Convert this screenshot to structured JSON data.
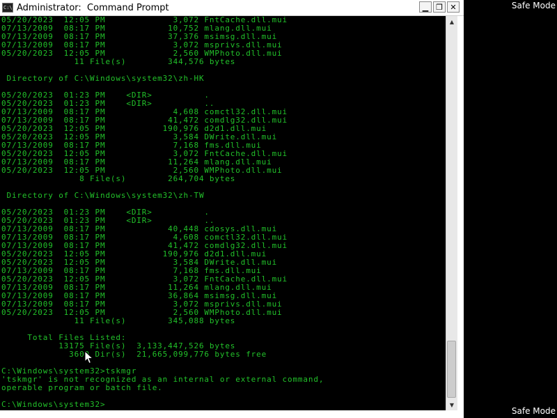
{
  "desktop": {
    "mode_label_top": "Safe Mode",
    "mode_label_bottom": "Safe Mode"
  },
  "window": {
    "title": "Administrator:  Command Prompt",
    "icon": "cmd-icon",
    "buttons": {
      "minimize_glyph": "▁",
      "maximize_glyph": "❐",
      "close_glyph": "✕"
    }
  },
  "console": {
    "text_color": "#22c22a",
    "background": "#000000",
    "lines": [
      "05/20/2023  12:05 PM             3,072 FntCache.dll.mui",
      "07/13/2009  08:17 PM            10,752 mlang.dll.mui",
      "07/13/2009  08:17 PM            37,376 msimsg.dll.mui",
      "07/13/2009  08:17 PM             3,072 msprivs.dll.mui",
      "05/20/2023  12:05 PM             2,560 WMPhoto.dll.mui",
      "              11 File(s)        344,576 bytes",
      "",
      " Directory of C:\\Windows\\system32\\zh-HK",
      "",
      "05/20/2023  01:23 PM    <DIR>          .",
      "05/20/2023  01:23 PM    <DIR>          ..",
      "07/13/2009  08:17 PM             4,608 comctl32.dll.mui",
      "07/13/2009  08:17 PM            41,472 comdlg32.dll.mui",
      "05/20/2023  12:05 PM           190,976 d2d1.dll.mui",
      "05/20/2023  12:05 PM             3,584 DWrite.dll.mui",
      "07/13/2009  08:17 PM             7,168 fms.dll.mui",
      "05/20/2023  12:05 PM             3,072 FntCache.dll.mui",
      "07/13/2009  08:17 PM            11,264 mlang.dll.mui",
      "05/20/2023  12:05 PM             2,560 WMPhoto.dll.mui",
      "               8 File(s)        264,704 bytes",
      "",
      " Directory of C:\\Windows\\system32\\zh-TW",
      "",
      "05/20/2023  01:23 PM    <DIR>          .",
      "05/20/2023  01:23 PM    <DIR>          ..",
      "07/13/2009  08:17 PM            40,448 cdosys.dll.mui",
      "07/13/2009  08:17 PM             4,608 comctl32.dll.mui",
      "07/13/2009  08:17 PM            41,472 comdlg32.dll.mui",
      "05/20/2023  12:05 PM           190,976 d2d1.dll.mui",
      "05/20/2023  12:05 PM             3,584 DWrite.dll.mui",
      "07/13/2009  08:17 PM             7,168 fms.dll.mui",
      "05/20/2023  12:05 PM             3,072 FntCache.dll.mui",
      "07/13/2009  08:17 PM            11,264 mlang.dll.mui",
      "07/13/2009  08:17 PM            36,864 msimsg.dll.mui",
      "07/13/2009  08:17 PM             3,072 msprivs.dll.mui",
      "05/20/2023  12:05 PM             2,560 WMPhoto.dll.mui",
      "              11 File(s)        345,088 bytes",
      "",
      "     Total Files Listed:",
      "           13175 File(s)  3,133,447,526 bytes",
      "             3609 Dir(s)  21,665,099,776 bytes free",
      "",
      "C:\\Windows\\system32>tskmgr",
      "'tskmgr' is not recognized as an internal or external command,",
      "operable program or batch file.",
      "",
      "C:\\Windows\\system32>"
    ]
  },
  "scrollbar": {
    "up_glyph": "▲",
    "down_glyph": "▼"
  }
}
